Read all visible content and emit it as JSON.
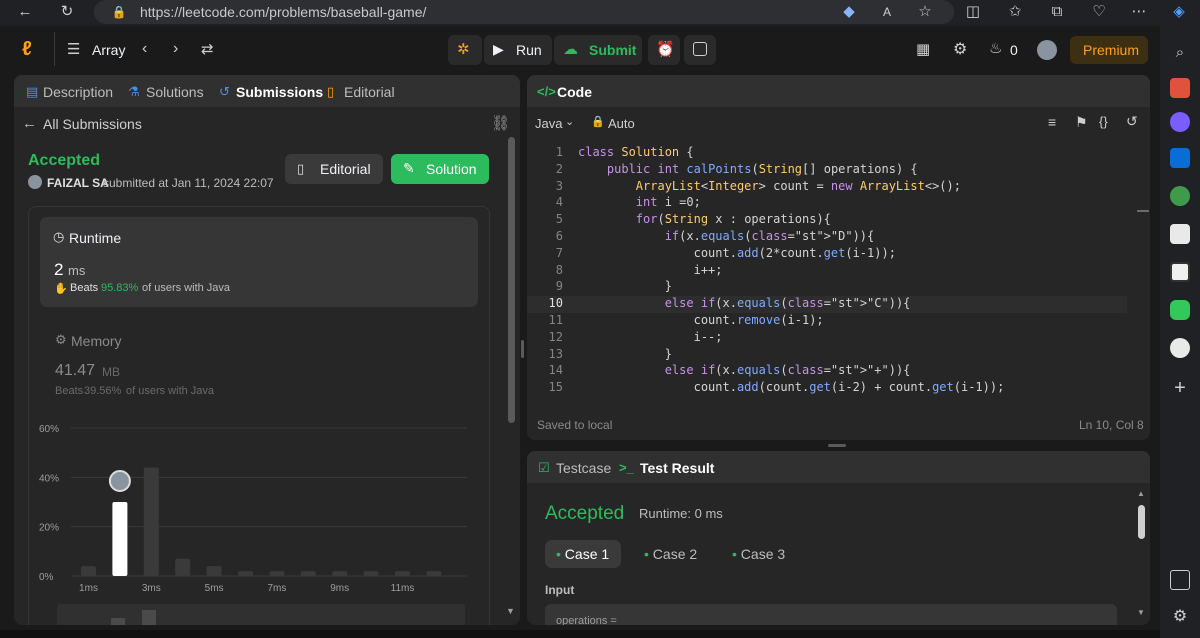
{
  "browser": {
    "url": "https://leetcode.com/problems/baseball-game/"
  },
  "topbar": {
    "problem_list": "Array",
    "run_label": "Run",
    "submit_label": "Submit",
    "streak_count": "0",
    "premium_label": "Premium"
  },
  "left_panel": {
    "tabs": [
      "Description",
      "Solutions",
      "Submissions",
      "Editorial"
    ],
    "back_label": "All Submissions",
    "status": "Accepted",
    "author": "FAIZAL SA",
    "submitted_text": "submitted at Jan 11, 2024 22:07",
    "editorial_button": "Editorial",
    "solution_button": "Solution",
    "runtime": {
      "title": "Runtime",
      "value": "2",
      "unit": "ms",
      "beats_prefix": "Beats",
      "beats_percent": "95.83%",
      "beats_suffix": "of users with Java"
    },
    "memory": {
      "title": "Memory",
      "value": "41.47",
      "unit": "MB",
      "beats_prefix": "Beats",
      "beats_percent": "39.56%",
      "beats_suffix": "of users with Java"
    }
  },
  "chart_data": {
    "type": "bar",
    "y_ticks": [
      "60%",
      "40%",
      "20%",
      "0%"
    ],
    "ylim": [
      0,
      60
    ],
    "x_tick_labels": [
      "1ms",
      "3ms",
      "5ms",
      "7ms",
      "9ms",
      "11ms"
    ],
    "values": [
      4,
      30,
      44,
      7,
      4,
      2,
      2,
      2,
      2,
      2,
      2,
      2
    ],
    "highlight_index": 1
  },
  "code_panel": {
    "title": "Code",
    "language": "Java",
    "auto_label": "Auto",
    "saved_label": "Saved to local",
    "cursor_pos": "Ln 10, Col 8",
    "current_line": 10,
    "lines": [
      "class Solution {",
      "    public int calPoints(String[] operations) {",
      "        ArrayList<Integer> count = new ArrayList<>();",
      "        int i =0;",
      "        for(String x : operations){",
      "            if(x.equals(\"D\")){",
      "                count.add(2*count.get(i-1));",
      "                i++;",
      "            }",
      "            else if(x.equals(\"C\")){",
      "                count.remove(i-1);",
      "                i--;",
      "            }",
      "            else if(x.equals(\"+\")){",
      "                count.add(count.get(i-2) + count.get(i-1));"
    ]
  },
  "result_panel": {
    "testcase_tab": "Testcase",
    "result_tab": "Test Result",
    "status": "Accepted",
    "runtime_text": "Runtime: 0 ms",
    "cases": [
      "Case 1",
      "Case 2",
      "Case 3"
    ],
    "input_label": "Input",
    "input_preview": "operations ="
  },
  "colors": {
    "accent_green": "#2cbb5d",
    "premium_orange": "#ffa116"
  }
}
